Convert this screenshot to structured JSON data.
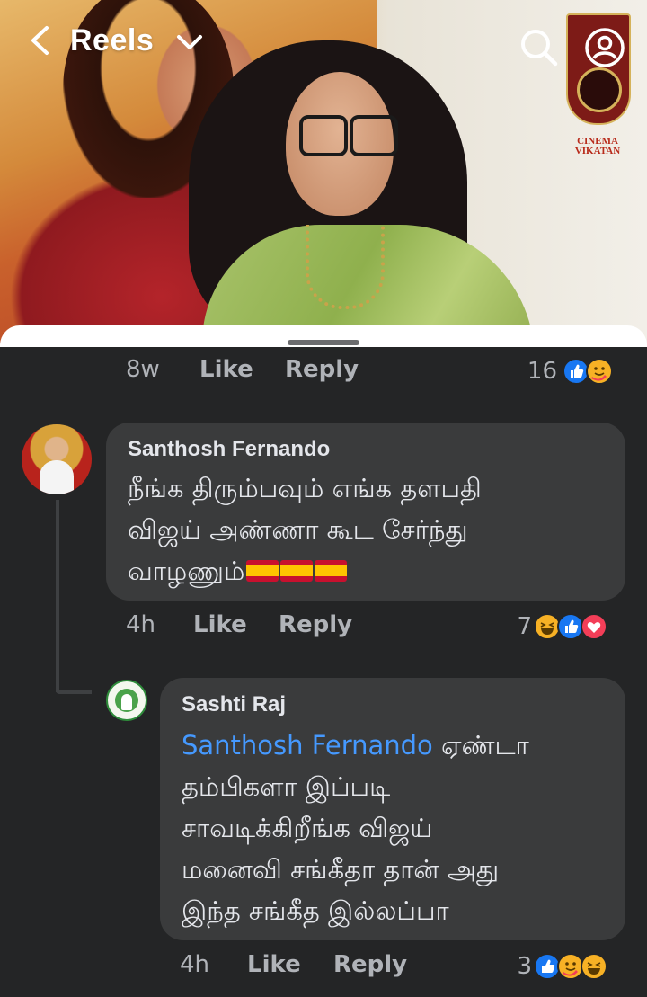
{
  "header": {
    "title": "Reels",
    "channel_logo_text": "CINEMA VIKATAN"
  },
  "comments": [
    {
      "time": "8w",
      "like_label": "Like",
      "reply_label": "Reply",
      "reaction_count": "16",
      "reactions": [
        "like-icon",
        "care-icon"
      ]
    },
    {
      "author": "Santhosh Fernando",
      "text": "நீங்க திரும்பவும் எங்க தளபதி\nவிஜய் அண்ணா கூட சேர்ந்து\nவாழணும்",
      "emoji": [
        "spain-flag-icon",
        "spain-flag-icon",
        "spain-flag-icon"
      ],
      "time": "4h",
      "like_label": "Like",
      "reply_label": "Reply",
      "reaction_count": "7",
      "reactions": [
        "haha-icon",
        "like-icon",
        "love-icon"
      ]
    },
    {
      "author": "Sashti Raj",
      "mention": "Santhosh Fernando",
      "text_first": " ஏண்டா",
      "text_rest": "தம்பிகளா இப்படி\nசாவடிக்கிறீங்க விஜய்\nமனைவி சங்கீதா தான் அது\nஇந்த சங்கீத இல்லப்பா",
      "time": "4h",
      "like_label": "Like",
      "reply_label": "Reply",
      "reaction_count": "3",
      "reactions": [
        "like-icon",
        "care-icon",
        "haha-icon"
      ]
    }
  ],
  "colors": {
    "background": "#242526",
    "bubble": "#3a3b3c",
    "mention": "#4599ff",
    "like_blue": "#1877f2",
    "love_red": "#f33e58",
    "haha_yellow": "#f7b125"
  }
}
